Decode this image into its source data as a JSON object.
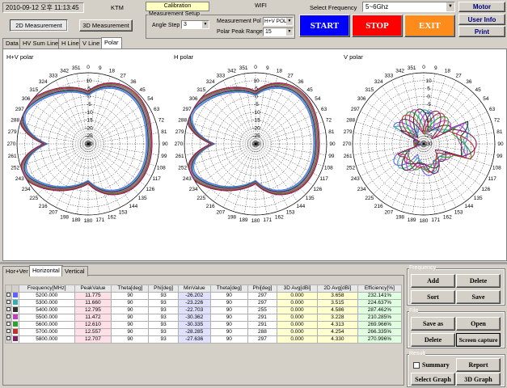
{
  "header": {
    "datetime": "2010-09-12 오후 11:13:45",
    "company": "KTM",
    "btn_2d": "2D Measurement",
    "btn_3d": "3D Measurement",
    "calibration": "Calibration",
    "wifi": "WIFI",
    "measurement_setup": "Measurement Setup",
    "angle_step_label": "Angle Step",
    "angle_step_value": "3",
    "measurement_pol_label": "Measurement Pol",
    "measurement_pol_value": "H+V POL",
    "polar_peak_range_label": "Polar Peak Range",
    "polar_peak_range_value": "15",
    "select_frequency_label": "Select Frequency",
    "select_frequency_value": "5~6Ghz",
    "start": "START",
    "stop": "STOP",
    "exit": "EXIT",
    "motor": "Motor",
    "user_info": "User Info",
    "print": "Print"
  },
  "tabs": [
    "Data",
    "HV Sum Line",
    "H Line",
    "V Line",
    "Polar"
  ],
  "polar_titles": [
    "H+V polar",
    "H polar",
    "V polar"
  ],
  "angle_labels": [
    "0",
    "9",
    "18",
    "27",
    "36",
    "45",
    "54",
    "63",
    "72",
    "81",
    "90",
    "99",
    "108",
    "117",
    "126",
    "135",
    "144",
    "153",
    "162",
    "171",
    "180",
    "189",
    "198",
    "207",
    "216",
    "225",
    "234",
    "243",
    "252",
    "261",
    "270",
    "279",
    "288",
    "297",
    "306",
    "315",
    "324",
    "333",
    "342",
    "351"
  ],
  "radial_labels": [
    "-30",
    "-25",
    "-20",
    "-15",
    "-10",
    "-5",
    "0",
    "5",
    "10"
  ],
  "bottom_tabs": [
    "Hor+Ver",
    "Horizontal",
    "Vertical"
  ],
  "table": {
    "headers": [
      "Frequency[MHz]",
      "PeakValue",
      "Theta[deg]",
      "Phi[deg]",
      "MinValue",
      "Theta[deg]",
      "Phi[deg]",
      "3D Avg[dBi]",
      "2D Avg[dBi]",
      "Efficiency[%]"
    ],
    "rows": [
      {
        "color": "#6060ff",
        "freq": "5200.000",
        "peak": "11.775",
        "theta": "90",
        "phi": "93",
        "min": "-26.202",
        "theta2": "90",
        "phi2": "297",
        "avg3d": "0.000",
        "avg2d": "3.658",
        "eff": "232.141%"
      },
      {
        "color": "#30b0b0",
        "freq": "5300.000",
        "peak": "11.660",
        "theta": "90",
        "phi": "93",
        "min": "-23.226",
        "theta2": "90",
        "phi2": "297",
        "avg3d": "0.000",
        "avg2d": "3.515",
        "eff": "224.637%"
      },
      {
        "color": "#303030",
        "freq": "5400.000",
        "peak": "12.795",
        "theta": "90",
        "phi": "93",
        "min": "-22.703",
        "theta2": "90",
        "phi2": "255",
        "avg3d": "0.000",
        "avg2d": "4.586",
        "eff": "287.462%"
      },
      {
        "color": "#c040c0",
        "freq": "5500.000",
        "peak": "11.472",
        "theta": "90",
        "phi": "93",
        "min": "-30.362",
        "theta2": "90",
        "phi2": "291",
        "avg3d": "0.000",
        "avg2d": "3.228",
        "eff": "210.285%"
      },
      {
        "color": "#30a030",
        "freq": "5600.000",
        "peak": "12.610",
        "theta": "90",
        "phi": "93",
        "min": "-30.335",
        "theta2": "90",
        "phi2": "291",
        "avg3d": "0.000",
        "avg2d": "4.313",
        "eff": "269.966%"
      },
      {
        "color": "#c03030",
        "freq": "5700.000",
        "peak": "12.557",
        "theta": "90",
        "phi": "93",
        "min": "-28.285",
        "theta2": "90",
        "phi2": "288",
        "avg3d": "0.000",
        "avg2d": "4.254",
        "eff": "266.335%"
      },
      {
        "color": "#802060",
        "freq": "5800.000",
        "peak": "12.707",
        "theta": "90",
        "phi": "93",
        "min": "-27.636",
        "theta2": "90",
        "phi2": "297",
        "avg3d": "0.000",
        "avg2d": "4.330",
        "eff": "270.996%"
      }
    ]
  },
  "right_panel": {
    "frequency_group": "Frequency",
    "add": "Add",
    "delete": "Delete",
    "sort": "Sort",
    "save": "Save",
    "file_group": "File",
    "save_as": "Save as",
    "open": "Open",
    "file_delete": "Delete",
    "screen_capture": "Screen capture",
    "result_group": "Result",
    "summary": "Summary",
    "report": "Report",
    "select_graph": "Select Graph",
    "graph3d": "3D Graph"
  }
}
